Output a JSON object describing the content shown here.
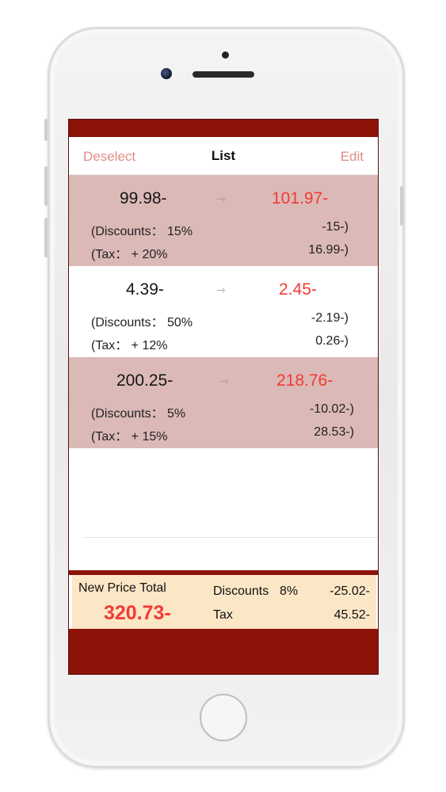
{
  "colors": {
    "accent_red": "#8b1308",
    "row_shade": "#dbb9b7",
    "new_price_red": "#f23a34",
    "nav_action": "#e08c88",
    "summary_bg": "#fbe6c6"
  },
  "nav": {
    "left_label": "Deselect",
    "title": "List",
    "right_label": "Edit"
  },
  "items": [
    {
      "price": "99.98-",
      "arrow": "⇾",
      "new_price": "101.97-",
      "discount_label": "(Discounts： 15%",
      "discount_value": "-15-)",
      "tax_label": "(Tax： + 20%",
      "tax_value": "16.99-)"
    },
    {
      "price": "4.39-",
      "arrow": "⇾",
      "new_price": "2.45-",
      "discount_label": "(Discounts： 50%",
      "discount_value": "-2.19-)",
      "tax_label": "(Tax： + 12%",
      "tax_value": "0.26-)"
    },
    {
      "price": "200.25-",
      "arrow": "⇾",
      "new_price": "218.76-",
      "discount_label": "(Discounts： 5%",
      "discount_value": "-10.02-)",
      "tax_label": "(Tax： + 15%",
      "tax_value": "28.53-)"
    }
  ],
  "summary": {
    "title": "New Price Total",
    "total": "320.73-",
    "discounts_label": "Discounts",
    "discounts_pct": "8%",
    "discounts_value": "-25.02-",
    "tax_label": "Tax",
    "tax_value": "45.52-"
  }
}
